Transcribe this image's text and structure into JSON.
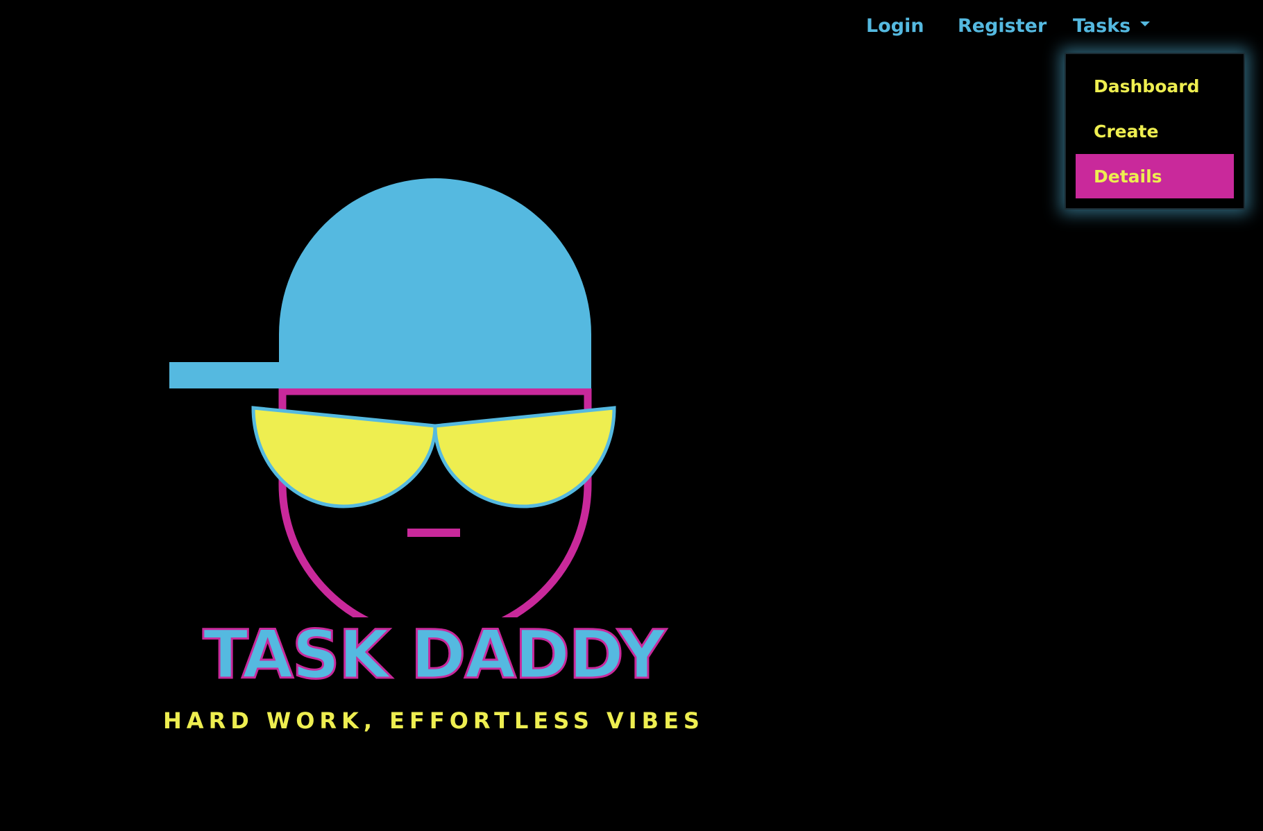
{
  "nav": {
    "login_label": "Login",
    "register_label": "Register",
    "tasks_label": "Tasks"
  },
  "tasks_menu": {
    "items": [
      {
        "label": "Dashboard",
        "active": false
      },
      {
        "label": "Create",
        "active": false
      },
      {
        "label": "Details",
        "active": true
      }
    ]
  },
  "brand": {
    "title": "TASK DADDY",
    "tagline": "HARD WORK, EFFORTLESS VIBES"
  },
  "colors": {
    "background": "#000000",
    "cyan": "#55b9e0",
    "magenta": "#c9299b",
    "yellow": "#eeee50"
  },
  "icons": {
    "dropdown_caret": "caret-down-icon",
    "logo": "cool-guy-cap-sunglasses-logo"
  }
}
